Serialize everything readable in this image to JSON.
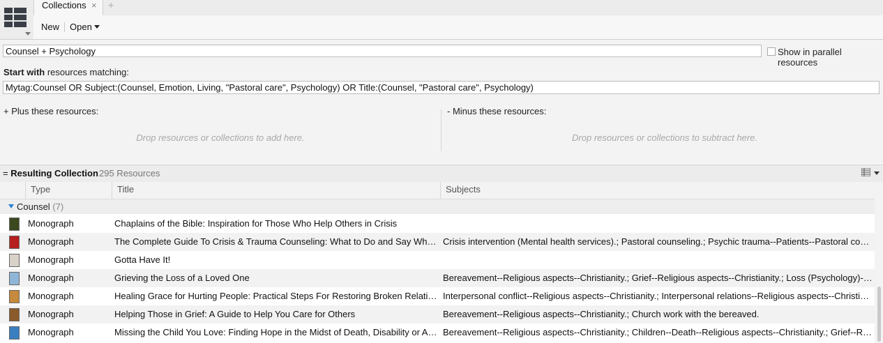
{
  "app": {
    "tab_label": "Collections",
    "tab_close": "×",
    "tab_add": "+"
  },
  "toolbar": {
    "new_label": "New",
    "open_label": "Open"
  },
  "editor": {
    "collection_name": "Counsel + Psychology",
    "parallel_label": "Show in parallel resources",
    "parallel_checked": false,
    "start_with_bold": "Start with",
    "start_with_rest": " resources matching:",
    "query": "Mytag:Counsel OR Subject:(Counsel, Emotion, Living, \"Pastoral care\", Psychology) OR Title:(Counsel, \"Pastoral care\", Psychology)",
    "plus_label": "+ Plus these resources:",
    "minus_label": "- Minus these resources:",
    "drop_add": "Drop resources or collections to add here.",
    "drop_subtract": "Drop resources or collections to subtract here."
  },
  "results": {
    "title_prefix": "= ",
    "title": "Resulting Collection",
    "count": "295 Resources"
  },
  "columns": {
    "type": "Type",
    "title": "Title",
    "subjects": "Subjects"
  },
  "group": {
    "label": "Counsel",
    "count": "(7)"
  },
  "rows": [
    {
      "type": "Monograph",
      "title": "Chaplains of the Bible: Inspiration for Those Who Help Others in Crisis",
      "subjects": "",
      "thumb_color": "#3b4a1e"
    },
    {
      "type": "Monograph",
      "title": "The Complete Guide To Crisis & Trauma Counseling: What to Do and Say When It Matters Most!",
      "subjects": "Crisis intervention (Mental health services).; Pastoral counseling.; Psychic trauma--Patients--Pastoral counseling of.",
      "thumb_color": "#b51f1f"
    },
    {
      "type": "Monograph",
      "title": "Gotta Have It!",
      "subjects": "",
      "thumb_color": "#d9d2c9"
    },
    {
      "type": "Monograph",
      "title": "Grieving the Loss of a Loved One",
      "subjects": "Bereavement--Religious aspects--Christianity.; Grief--Religious aspects--Christianity.; Loss (Psychology)--Religious aspects--Christianity.",
      "thumb_color": "#8fb6d6"
    },
    {
      "type": "Monograph",
      "title": "Healing Grace for Hurting People: Practical Steps For Restoring Broken Relationships",
      "subjects": "Interpersonal conflict--Religious aspects--Christianity.; Interpersonal relations--Religious aspects--Christianity.; Reconciliation.",
      "thumb_color": "#c58a3c"
    },
    {
      "type": "Monograph",
      "title": "Helping Those in Grief: A Guide to Help You Care for Others",
      "subjects": "Bereavement--Religious aspects--Christianity.; Church work with the bereaved.",
      "thumb_color": "#8a5a2b"
    },
    {
      "type": "Monograph",
      "title": "Missing the Child You Love: Finding Hope in the Midst of Death, Disability or Absence",
      "subjects": "Bereavement--Religious aspects--Christianity.; Children--Death--Religious aspects--Christianity.; Grief--Religious aspects--Christianity.",
      "thumb_color": "#3a7fc0"
    }
  ]
}
